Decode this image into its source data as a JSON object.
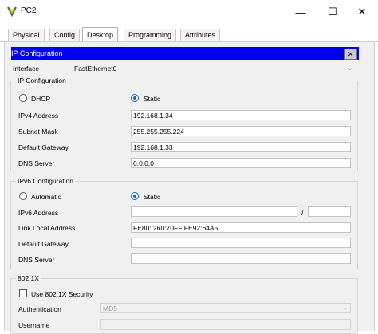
{
  "window": {
    "title": "PC2",
    "minimize": "—",
    "maximize": "☐",
    "close": "✕"
  },
  "tabs": [
    "Physical",
    "Config",
    "Desktop",
    "Programming",
    "Attributes"
  ],
  "panel": {
    "title": "IP Configuration",
    "close": "✕"
  },
  "interface": {
    "label": "Interface",
    "value": "FastEthernet0"
  },
  "ipv4": {
    "group_title": "IP Configuration",
    "dhcp_label": "DHCP",
    "static_label": "Static",
    "mode": "Static",
    "address_label": "IPv4 Address",
    "address": "192.168.1.34",
    "mask_label": "Subnet Mask",
    "mask": "255.255.255.224",
    "gateway_label": "Default Gateway",
    "gateway": "192.168.1.33",
    "dns_label": "DNS Server",
    "dns": "0.0.0.0"
  },
  "ipv6": {
    "group_title": "IPv6 Configuration",
    "auto_label": "Automatic",
    "static_label": "Static",
    "mode": "Static",
    "address_label": "IPv6 Address",
    "address": "",
    "prefix_sep": "/",
    "prefix": "",
    "link_local_label": "Link Local Address",
    "link_local": "FE80::260:70FF:FE92:64A5",
    "gateway_label": "Default Gateway",
    "gateway": "",
    "dns_label": "DNS Server",
    "dns": ""
  },
  "dot1x": {
    "group_title": "802.1X",
    "use_label": "Use 802.1X Security",
    "checked": false,
    "auth_label": "Authentication",
    "auth_value": "MD5",
    "username_label": "Username",
    "username": ""
  },
  "icons": {
    "app": "pc-app-icon",
    "dropdown": "chevron-down-icon"
  },
  "colors": {
    "header_bg": "#0000ee",
    "radio_accent": "#1565c0"
  }
}
